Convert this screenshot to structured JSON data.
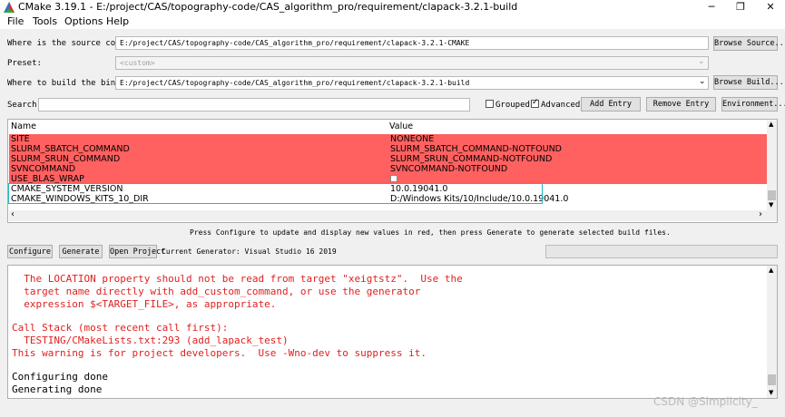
{
  "window": {
    "title": "CMake 3.19.1 - E:/project/CAS/topography-code/CAS_algorithm_pro/requirement/clapack-3.2.1-build",
    "minimize": "─",
    "maximize": "❐",
    "close": "✕"
  },
  "menu": [
    "File",
    "Tools",
    "Options",
    "Help"
  ],
  "source": {
    "label": "Where is the source code:",
    "value": "E:/project/CAS/topography-code/CAS_algorithm_pro/requirement/clapack-3.2.1-CMAKE",
    "button": "Browse Source..."
  },
  "preset": {
    "label": "Preset:",
    "value": "<custom>"
  },
  "build": {
    "label": "Where to build the binaries:",
    "value": "E:/project/CAS/topography-code/CAS_algorithm_pro/requirement/clapack-3.2.1-build",
    "button": "Browse Build..."
  },
  "search": {
    "label": "Search:",
    "value": "",
    "grouped_label": "Grouped",
    "grouped_checked": false,
    "advanced_label": "Advanced",
    "advanced_checked": true,
    "add_entry": "Add Entry",
    "remove_entry": "Remove Entry",
    "environment": "Environment..."
  },
  "table": {
    "headers": [
      "Name",
      "Value"
    ],
    "rows": [
      {
        "name": "SITE",
        "value": "NONEONE",
        "new": true
      },
      {
        "name": "SLURM_SBATCH_COMMAND",
        "value": "SLURM_SBATCH_COMMAND-NOTFOUND",
        "new": true
      },
      {
        "name": "SLURM_SRUN_COMMAND",
        "value": "SLURM_SRUN_COMMAND-NOTFOUND",
        "new": true
      },
      {
        "name": "SVNCOMMAND",
        "value": "SVNCOMMAND-NOTFOUND",
        "new": true
      },
      {
        "name": "USE_BLAS_WRAP",
        "value": "",
        "new": true,
        "checkbox": true
      },
      {
        "name": "CMAKE_SYSTEM_VERSION",
        "value": "10.0.19041.0",
        "new": false
      },
      {
        "name": "CMAKE_WINDOWS_KITS_10_DIR",
        "value": "D:/Windows Kits/10/Include/10.0.19041.0",
        "new": false
      }
    ]
  },
  "hint": "Press Configure to update and display new values in red, then press Generate to generate selected build files.",
  "actions": {
    "configure": "Configure",
    "generate": "Generate",
    "open_project": "Open Project",
    "generator": "Current Generator: Visual Studio 16 2019"
  },
  "log": [
    {
      "text": "  The LOCATION property should not be read from target \"xeigtstz\".  Use the",
      "err": true
    },
    {
      "text": "  target name directly with add_custom_command, or use the generator",
      "err": true
    },
    {
      "text": "  expression $<TARGET_FILE>, as appropriate.",
      "err": true
    },
    {
      "text": "",
      "err": false
    },
    {
      "text": "Call Stack (most recent call first):",
      "err": true
    },
    {
      "text": "  TESTING/CMakeLists.txt:293 (add_lapack_test)",
      "err": true
    },
    {
      "text": "This warning is for project developers.  Use -Wno-dev to suppress it.",
      "err": true
    },
    {
      "text": "",
      "err": false
    },
    {
      "text": "Configuring done",
      "err": false
    },
    {
      "text": "Generating done",
      "err": false
    }
  ],
  "watermark": "CSDN @Simplicity_",
  "colors": {
    "new_entry_bg": "#ff6060",
    "highlight_box": "#20b8c0",
    "log_error": "#e02020"
  }
}
